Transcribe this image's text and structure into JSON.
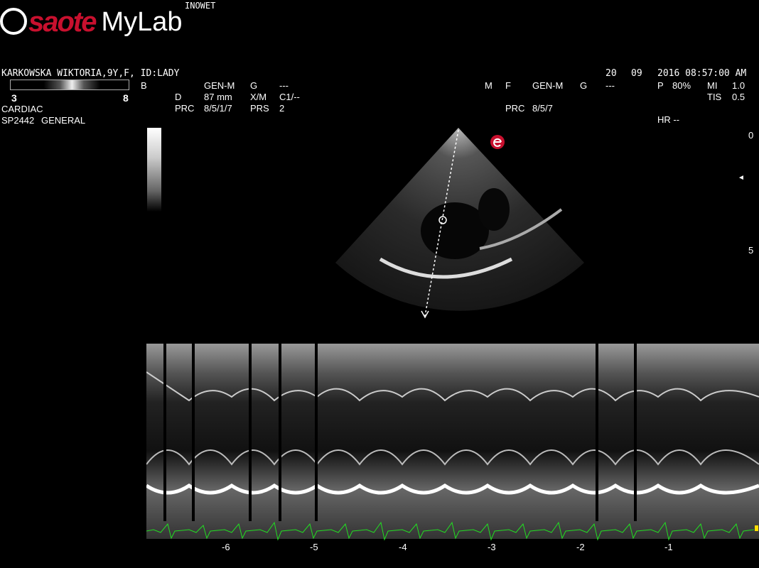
{
  "header": {
    "brand": "saote",
    "product": "MyLab",
    "center_name": "INOWET",
    "patient": "KARKOWSKA WIKTORIA,9Y,F, ID:LADY",
    "date_day": "20",
    "date_month": "09",
    "date_time": "2016 08:57:00 AM",
    "exam": "CARDIAC",
    "probe": "SP2442",
    "preset": "GENERAL"
  },
  "colorbar": {
    "min": "3",
    "max": "8"
  },
  "b_mode": {
    "label": "B",
    "freq": "GEN-M",
    "gain_label": "G",
    "gain_value": "---",
    "depth_label": "D",
    "depth_value": "87 mm",
    "xm_label": "X/M",
    "xm_value": "C1/--",
    "prc_label": "PRC",
    "prc_value": "8/5/1/7",
    "prs_label": "PRS",
    "prs_value": "2"
  },
  "m_mode": {
    "label": "M",
    "f_label": "F",
    "freq": "GEN-M",
    "gain_label": "G",
    "gain_value": "---",
    "prc_label": "PRC",
    "prc_value": "8/5/7"
  },
  "output": {
    "p_label": "P",
    "p_value": "80%",
    "mi_label": "MI",
    "mi_value": "1.0",
    "tis_label": "TIS",
    "tis_value": "0.5",
    "hr": "HR --"
  },
  "depth_scale": {
    "top": "0",
    "mid": "5",
    "marker": "◄"
  },
  "time_axis": [
    "-6",
    "-5",
    "-4",
    "-3",
    "-2",
    "-1"
  ],
  "colors": {
    "logo_red": "#c8102e",
    "ecg": "#22dd22",
    "marker": "#ffdd00"
  }
}
